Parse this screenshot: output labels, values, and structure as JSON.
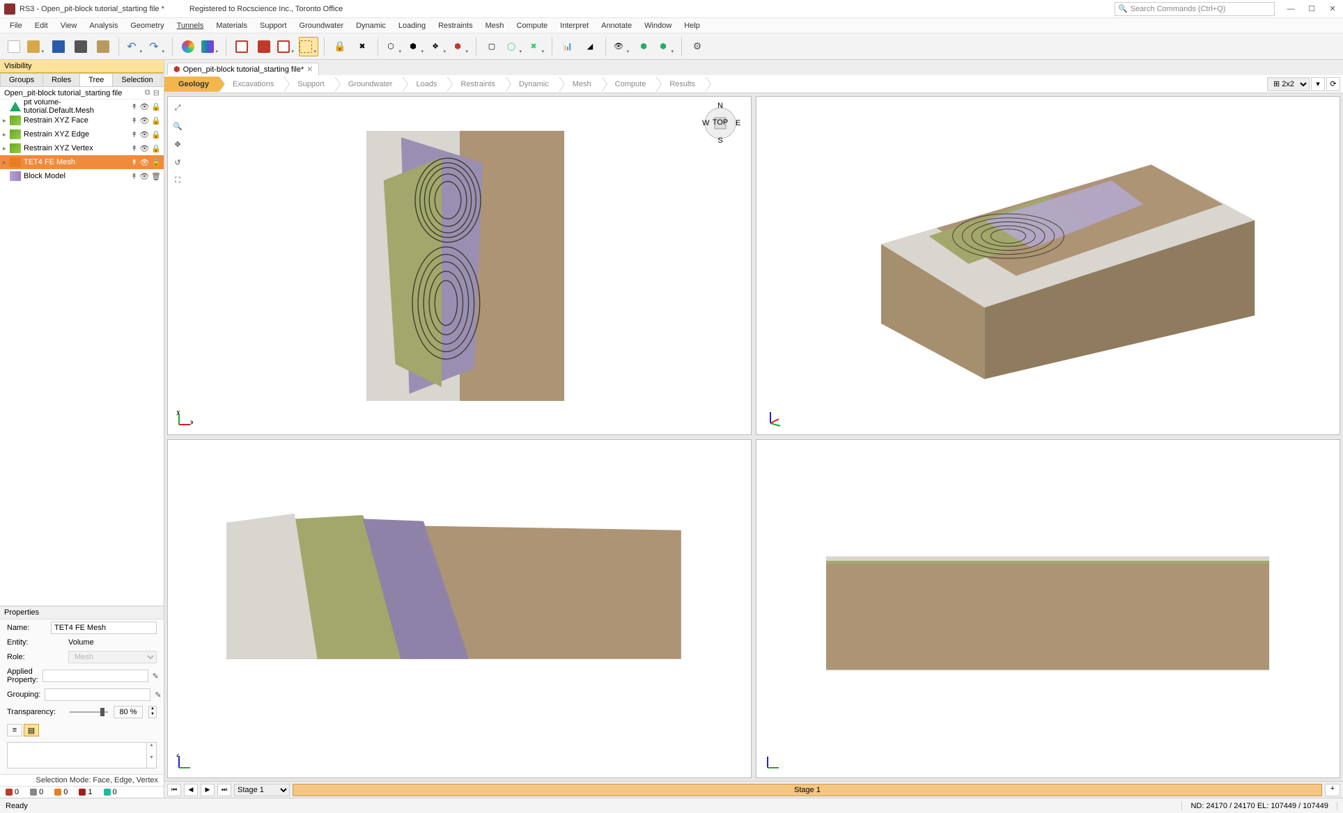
{
  "title": {
    "app": "RS3 - Open_pit-block tutorial_starting file *",
    "registration": "Registered to Rocscience Inc., Toronto Office"
  },
  "search_placeholder": "Search Commands (Ctrl+Q)",
  "menu": [
    "File",
    "Edit",
    "View",
    "Analysis",
    "Geometry",
    "Tunnels",
    "Materials",
    "Support",
    "Groundwater",
    "Dynamic",
    "Loading",
    "Restraints",
    "Mesh",
    "Compute",
    "Interpret",
    "Annotate",
    "Window",
    "Help"
  ],
  "doc_tab": "Open_pit-block tutorial_starting file*",
  "workflow": {
    "active": "Geology",
    "steps": [
      "Geology",
      "Excavations",
      "Support",
      "Groundwater",
      "Loads",
      "Restraints",
      "Dynamic",
      "Mesh",
      "Compute",
      "Results"
    ]
  },
  "view_layout": "2x2",
  "visibility": {
    "header": "Visibility",
    "tabs": [
      "Groups",
      "Roles",
      "Tree",
      "Selection"
    ],
    "active_tab": "Tree",
    "file": "Open_pit-block tutorial_starting file",
    "tree": [
      {
        "label": "pit volume-tutorial.Default.Mesh",
        "icon": "mesh",
        "expandable": false,
        "selected": false,
        "locked": true
      },
      {
        "label": "Restrain XYZ Face",
        "icon": "restr",
        "expandable": true,
        "selected": false,
        "locked": true
      },
      {
        "label": "Restrain XYZ Edge",
        "icon": "restr",
        "expandable": true,
        "selected": false,
        "locked": true
      },
      {
        "label": "Restrain XYZ Vertex",
        "icon": "restr",
        "expandable": true,
        "selected": false,
        "locked": true
      },
      {
        "label": "TET4 FE Mesh",
        "icon": "tet",
        "expandable": true,
        "selected": true,
        "locked": true
      },
      {
        "label": "Block Model",
        "icon": "block",
        "expandable": false,
        "selected": false,
        "locked": false
      }
    ]
  },
  "properties": {
    "header": "Properties",
    "name_lbl": "Name:",
    "name_val": "TET4 FE Mesh",
    "entity_lbl": "Entity:",
    "entity_val": "Volume",
    "role_lbl": "Role:",
    "role_val": "Mesh",
    "applied_lbl": "Applied Property:",
    "applied_val": "",
    "grouping_lbl": "Grouping:",
    "grouping_val": "",
    "transparency_lbl": "Transparency:",
    "transparency_val": "80 %",
    "transparency_pct": 80
  },
  "selection_mode": "Selection Mode: Face, Edge, Vertex",
  "counts": [
    {
      "color": "#c0392b",
      "v": "0"
    },
    {
      "color": "#888",
      "v": "0"
    },
    {
      "color": "#e67e22",
      "v": "0"
    },
    {
      "color": "#a02020",
      "v": "1"
    },
    {
      "color": "#1abc9c",
      "v": "0"
    }
  ],
  "stage": {
    "label": "Stage 1",
    "bar": "Stage 1"
  },
  "status": {
    "ready": "Ready",
    "coords": "ND: 24170 / 24170  EL: 107449 / 107449"
  },
  "compass": {
    "n": "N",
    "e": "E",
    "s": "S",
    "w": "W",
    "top": "TOP"
  }
}
